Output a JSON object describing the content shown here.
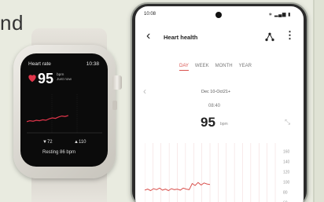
{
  "hero": {
    "fragment": "nd"
  },
  "watch": {
    "title": "Heart rate",
    "time": "10:38",
    "bpm": "95",
    "unit_line1": "bpm",
    "unit_line2": "Just now",
    "stat_a": "▼72",
    "stat_b": "▲110",
    "resting": "Resting 86 bpm",
    "series": [
      72,
      74,
      73,
      75,
      74,
      76,
      75,
      78,
      80,
      79,
      82,
      84,
      83,
      85
    ],
    "y_range": [
      50,
      130
    ],
    "accent": "#e0354a"
  },
  "phone": {
    "status_time": "10:08",
    "status_icons": "∗ ▂▄▆ ▮",
    "title": "Heart health",
    "tabs": [
      {
        "label": "DAY",
        "active": true
      },
      {
        "label": "WEEK",
        "active": false
      },
      {
        "label": "MONTH",
        "active": false
      },
      {
        "label": "YEAR",
        "active": false
      }
    ],
    "date_range": "Dec 10-Oct21+",
    "clock": "08:40",
    "value": "95",
    "value_unit": "bpm",
    "y_ticks": [
      "160",
      "140",
      "120",
      "100",
      "80",
      "60"
    ],
    "y_range": [
      50,
      170
    ],
    "series": [
      84,
      86,
      83,
      87,
      85,
      88,
      84,
      86,
      83,
      87,
      85,
      86,
      84,
      88,
      86,
      85,
      97,
      93,
      99,
      94,
      98,
      96,
      95
    ],
    "accent": "#d9534f"
  }
}
